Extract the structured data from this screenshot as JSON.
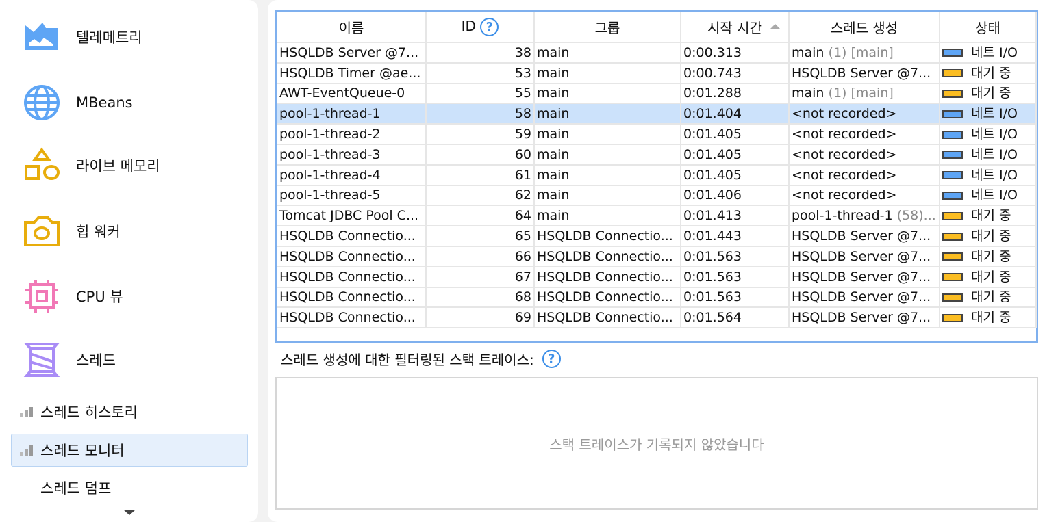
{
  "sidebar": {
    "items": [
      {
        "label": "텔레메트리",
        "icon": "telemetry-icon",
        "color": "#5ea5f5"
      },
      {
        "label": "MBeans",
        "icon": "globe-icon",
        "color": "#5ea5f5"
      },
      {
        "label": "라이브 메모리",
        "icon": "shapes-icon",
        "color": "#e8ad0c"
      },
      {
        "label": "힙 워커",
        "icon": "camera-icon",
        "color": "#e8ad0c"
      },
      {
        "label": "CPU 뷰",
        "icon": "chip-icon",
        "color": "#f178b6"
      },
      {
        "label": "스레드",
        "icon": "spool-icon",
        "color": "#a98cf6"
      }
    ],
    "subitems": [
      {
        "label": "스레드 히스토리"
      },
      {
        "label": "스레드 모니터",
        "selected": true
      },
      {
        "label": "스레드 덤프"
      }
    ]
  },
  "table": {
    "columns": [
      "이름",
      "ID",
      "그룹",
      "시작 시간",
      "스레드 생성",
      "상태"
    ],
    "rows": [
      [
        "HSQLDB Server @7...",
        "38",
        "main",
        "0:00.313",
        "main",
        "(1) [main]",
        "네트 I/O",
        "net"
      ],
      [
        "HSQLDB Timer @ae...",
        "53",
        "main",
        "0:00.743",
        "HSQLDB Server @7...",
        "",
        "대기 중",
        "wait"
      ],
      [
        "AWT-EventQueue-0",
        "55",
        "main",
        "0:01.288",
        "main",
        "(1) [main]",
        "대기 중",
        "wait"
      ],
      [
        "pool-1-thread-1",
        "58",
        "main",
        "0:01.404",
        "<not recorded>",
        "",
        "네트 I/O",
        "net"
      ],
      [
        "pool-1-thread-2",
        "59",
        "main",
        "0:01.405",
        "<not recorded>",
        "",
        "네트 I/O",
        "net"
      ],
      [
        "pool-1-thread-3",
        "60",
        "main",
        "0:01.405",
        "<not recorded>",
        "",
        "네트 I/O",
        "net"
      ],
      [
        "pool-1-thread-4",
        "61",
        "main",
        "0:01.405",
        "<not recorded>",
        "",
        "네트 I/O",
        "net"
      ],
      [
        "pool-1-thread-5",
        "62",
        "main",
        "0:01.406",
        "<not recorded>",
        "",
        "네트 I/O",
        "net"
      ],
      [
        "Tomcat JDBC Pool C...",
        "64",
        "main",
        "0:01.413",
        "pool-1-thread-1",
        "(58)...",
        "대기 중",
        "wait"
      ],
      [
        "HSQLDB Connectio...",
        "65",
        "HSQLDB Connectio...",
        "0:01.443",
        "HSQLDB Server @7...",
        "",
        "대기 중",
        "wait"
      ],
      [
        "HSQLDB Connectio...",
        "66",
        "HSQLDB Connectio...",
        "0:01.563",
        "HSQLDB Server @7...",
        "",
        "대기 중",
        "wait"
      ],
      [
        "HSQLDB Connectio...",
        "67",
        "HSQLDB Connectio...",
        "0:01.563",
        "HSQLDB Server @7...",
        "",
        "대기 중",
        "wait"
      ],
      [
        "HSQLDB Connectio...",
        "68",
        "HSQLDB Connectio...",
        "0:01.563",
        "HSQLDB Server @7...",
        "",
        "대기 중",
        "wait"
      ],
      [
        "HSQLDB Connectio...",
        "69",
        "HSQLDB Connectio...",
        "0:01.564",
        "HSQLDB Server @7...",
        "",
        "대기 중",
        "wait"
      ]
    ],
    "selected_row": 3,
    "sort_column": "시작 시간",
    "sort": "ascending",
    "status_colors": {
      "net": "#5ea5f5",
      "wait": "#fbbd22"
    }
  },
  "stack": {
    "label": "스레드 생성에 대한 필터링된 스택 트레이스:",
    "empty": "스택 트레이스가 기록되지 않았습니다"
  },
  "help": "?"
}
